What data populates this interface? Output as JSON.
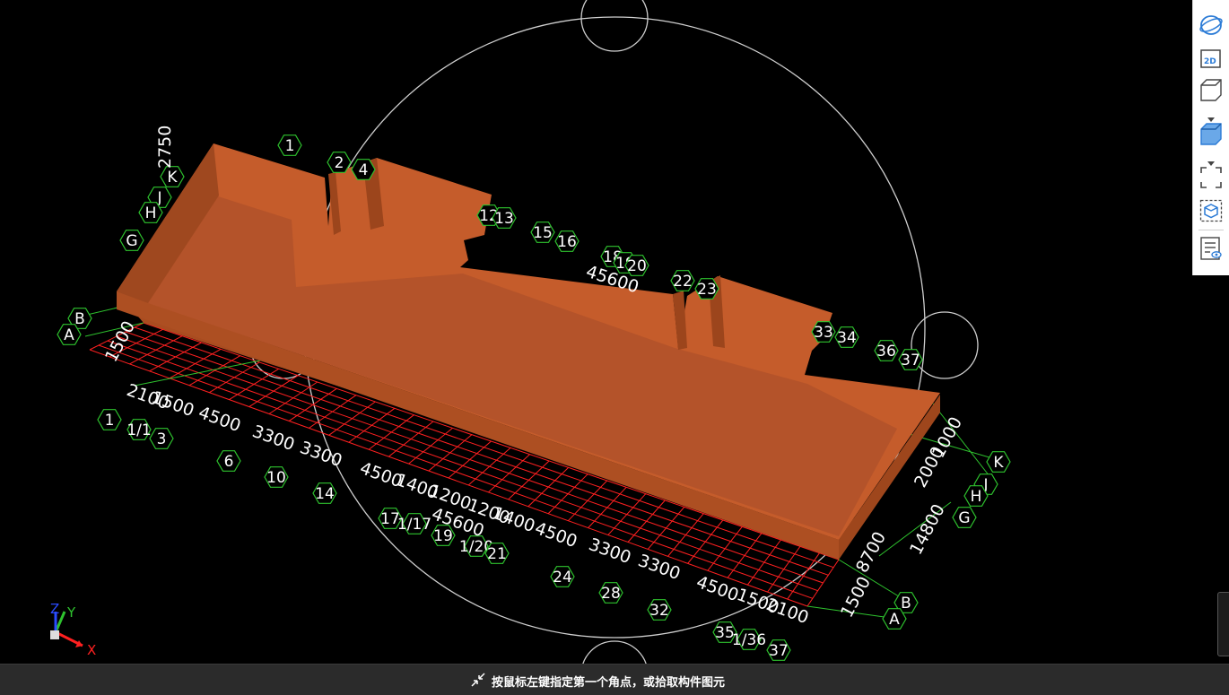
{
  "statusbar": {
    "message": "按鼠标左键指定第一个角点，或拾取构件图元"
  },
  "toolbar": {
    "buttons": [
      {
        "name": "dynamic-observe",
        "icon": "orbit-icon"
      },
      {
        "name": "2d-view",
        "icon": "2d-icon",
        "label": "2D"
      },
      {
        "name": "3d-wireframe-view",
        "icon": "cube-outline-icon"
      },
      {
        "name": "3d-solid-view",
        "icon": "cube-solid-icon"
      },
      {
        "name": "zoom-extents",
        "icon": "frame-corners-icon"
      },
      {
        "name": "partial-3d",
        "icon": "box-select-icon"
      },
      {
        "name": "display-settings",
        "icon": "list-eye-icon"
      }
    ]
  },
  "axis_triad": {
    "x": "X",
    "y": "Y",
    "z": "Z"
  },
  "axis_labels": {
    "top_numbers": [
      "1",
      "2",
      "4",
      "12",
      "13",
      "15",
      "16",
      "18",
      "19",
      "20",
      "22",
      "23",
      "33",
      "34",
      "36",
      "37"
    ],
    "bottom_numbers": [
      "1",
      "1/1",
      "3",
      "6",
      "10",
      "14",
      "17",
      "1/17",
      "19",
      "1/20",
      "21",
      "24",
      "28",
      "32",
      "35",
      "1/36",
      "37"
    ],
    "letters_left": [
      "K",
      "J",
      "H",
      "G",
      "B",
      "A"
    ],
    "letters_right": [
      "K",
      "J",
      "H",
      "G",
      "B",
      "A"
    ],
    "dims_top": [
      "2750",
      "45600"
    ],
    "dims_bottom": [
      "2100",
      "1500",
      "4500",
      "3300",
      "3300",
      "4500",
      "1400",
      "1200",
      "45600",
      "1200",
      "1400",
      "4500",
      "3300",
      "3300",
      "4500",
      "1500",
      "2100"
    ],
    "dims_right": [
      "1000",
      "2000",
      "14800",
      "8700",
      "1500"
    ],
    "dims_left": [
      "1500"
    ]
  },
  "colors": {
    "building_top": "#c55c2b",
    "building_side": "#a94c20",
    "grid_red": "#ff2020",
    "axis_green": "#2ec22e",
    "circle": "#cfcfcf"
  }
}
